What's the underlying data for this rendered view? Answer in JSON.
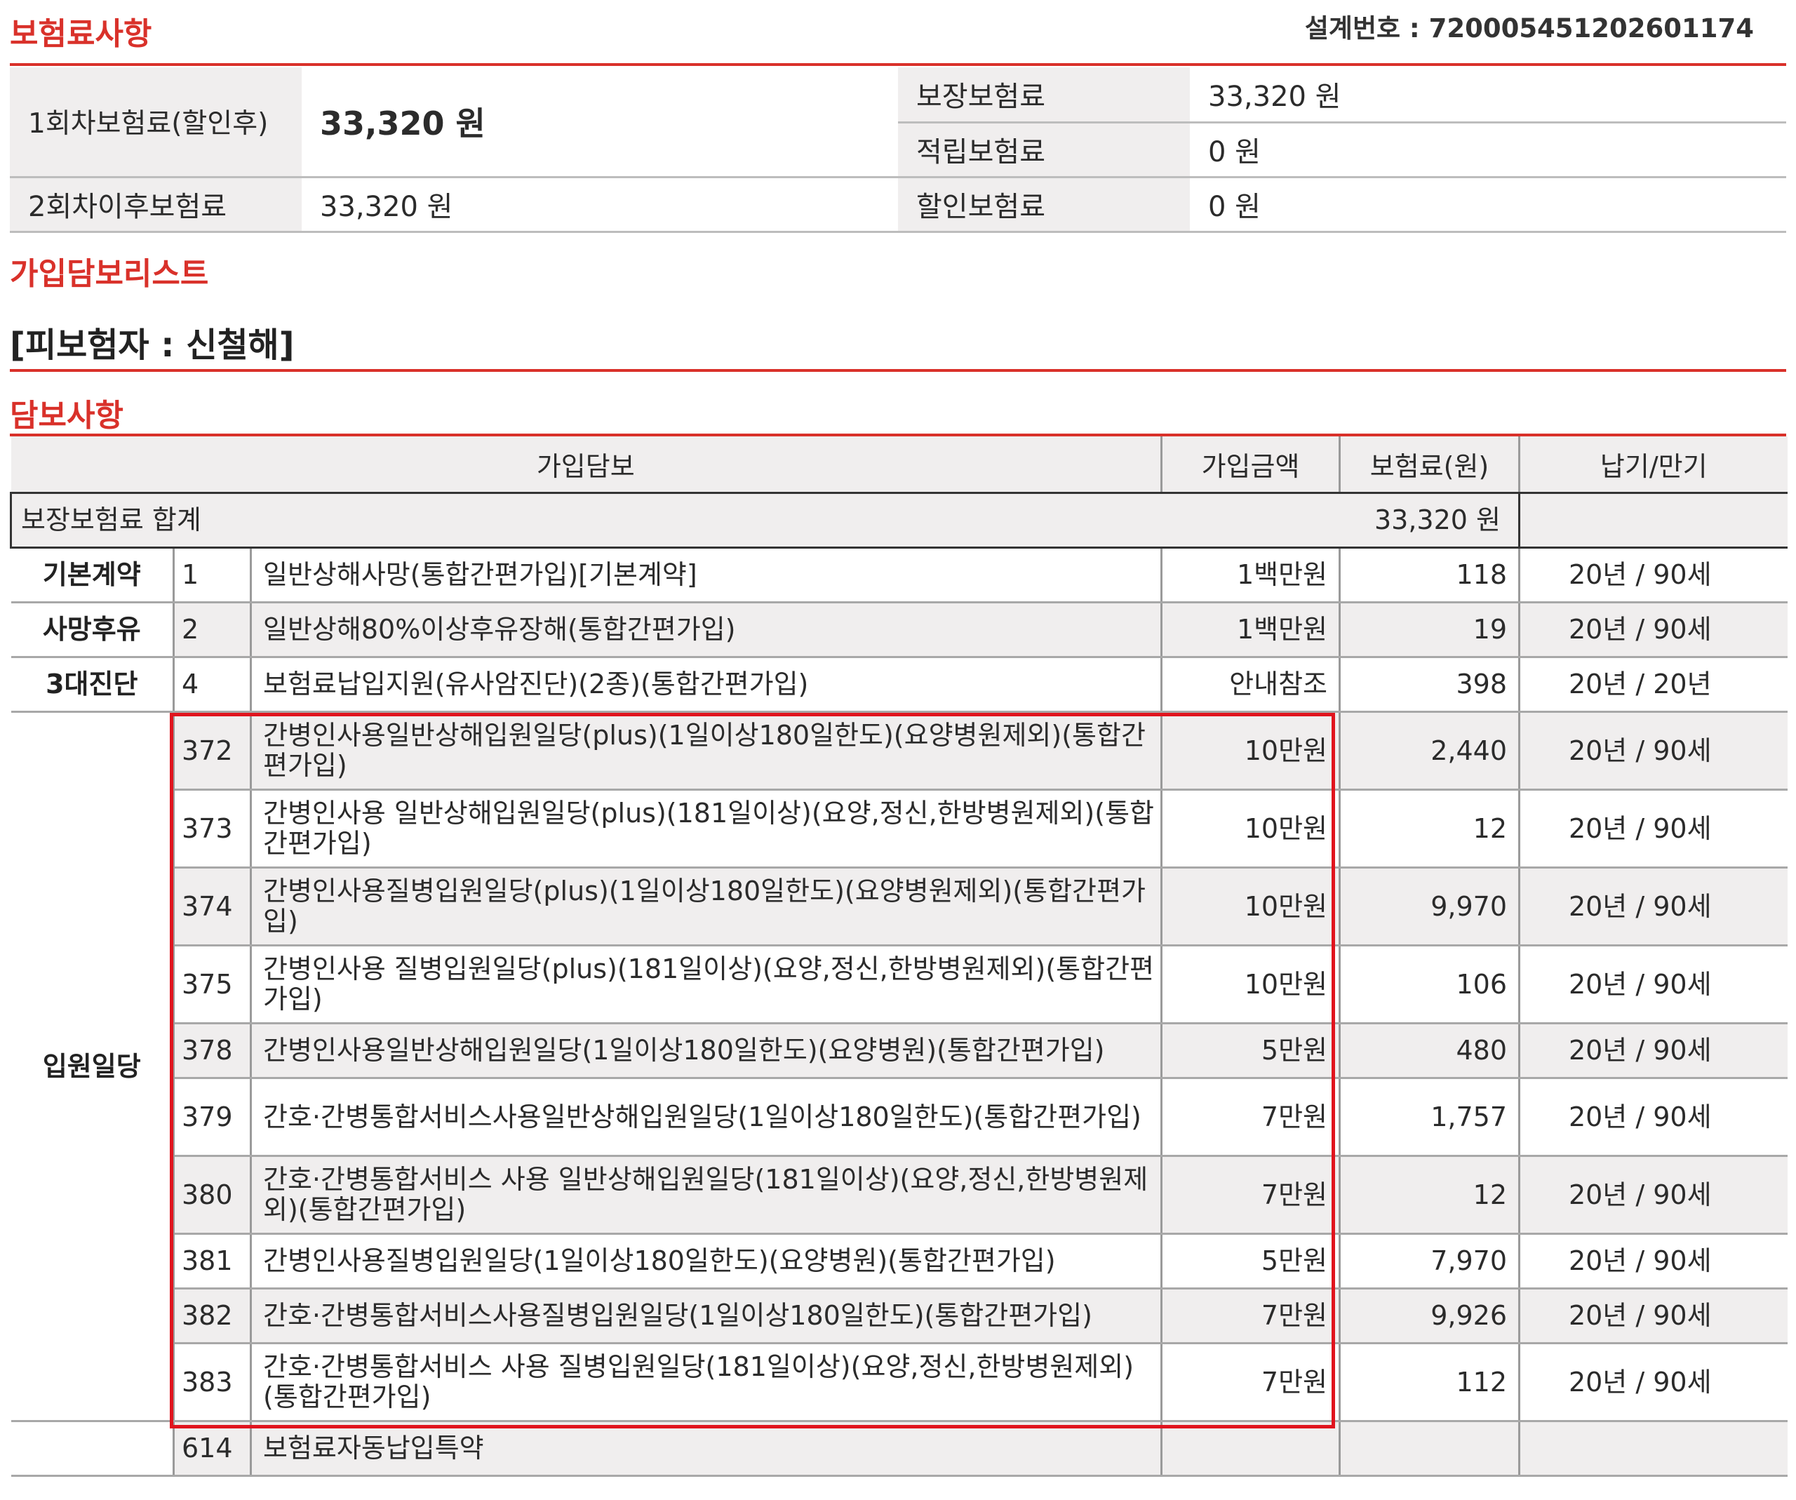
{
  "section1": {
    "title": "보험료사항",
    "design_no": "설계번호 : 720005451202601174"
  },
  "premium": {
    "first_label": "1회차보험료(할인후)",
    "first_value": "33,320 원",
    "after_label": "2회차이후보험료",
    "after_value": "33,320 원",
    "guarantee_label": "보장보험료",
    "guarantee_value": "33,320 원",
    "saving_label": "적립보험료",
    "saving_value": "0 원",
    "discount_label": "할인보험료",
    "discount_value": "0 원"
  },
  "section2": {
    "title": "가입담보리스트"
  },
  "insured": "[피보험자 : 신철해]",
  "section3": {
    "title": "담보사항"
  },
  "coverage": {
    "headers": {
      "name": "가입담보",
      "amount": "가입금액",
      "premium": "보험료(원)",
      "term": "납기/만기"
    },
    "sum_label": "보장보험료 합계",
    "sum_value": "33,320 원",
    "categories": {
      "basic": "기본계약",
      "death": "사망후유",
      "diag": "3대진단",
      "hosp": "입원일당"
    },
    "rows": [
      {
        "code": "1",
        "name": "일반상해사망(통합간편가입)[기본계약]",
        "amount": "1백만원",
        "premium": "118",
        "term": "20년 / 90세"
      },
      {
        "code": "2",
        "name": "일반상해80%이상후유장해(통합간편가입)",
        "amount": "1백만원",
        "premium": "19",
        "term": "20년 / 90세"
      },
      {
        "code": "4",
        "name": "보험료납입지원(유사암진단)(2종)(통합간편가입)",
        "amount": "안내참조",
        "premium": "398",
        "term": "20년 / 20년"
      },
      {
        "code": "372",
        "name": "간병인사용일반상해입원일당(plus)(1일이상180일한도)(요양병원제외)(통합간편가입)",
        "amount": "10만원",
        "premium": "2,440",
        "term": "20년 / 90세"
      },
      {
        "code": "373",
        "name": "간병인사용 일반상해입원일당(plus)(181일이상)(요양,정신,한방병원제외)(통합간편가입)",
        "amount": "10만원",
        "premium": "12",
        "term": "20년 / 90세"
      },
      {
        "code": "374",
        "name": "간병인사용질병입원일당(plus)(1일이상180일한도)(요양병원제외)(통합간편가입)",
        "amount": "10만원",
        "premium": "9,970",
        "term": "20년 / 90세"
      },
      {
        "code": "375",
        "name": "간병인사용 질병입원일당(plus)(181일이상)(요양,정신,한방병원제외)(통합간편가입)",
        "amount": "10만원",
        "premium": "106",
        "term": "20년 / 90세"
      },
      {
        "code": "378",
        "name": "간병인사용일반상해입원일당(1일이상180일한도)(요양병원)(통합간편가입)",
        "amount": "5만원",
        "premium": "480",
        "term": "20년 / 90세"
      },
      {
        "code": "379",
        "name": "간호·간병통합서비스사용일반상해입원일당(1일이상180일한도)(통합간편가입)",
        "amount": "7만원",
        "premium": "1,757",
        "term": "20년 / 90세"
      },
      {
        "code": "380",
        "name": "간호·간병통합서비스 사용 일반상해입원일당(181일이상)(요양,정신,한방병원제외)(통합간편가입)",
        "amount": "7만원",
        "premium": "12",
        "term": "20년 / 90세"
      },
      {
        "code": "381",
        "name": "간병인사용질병입원일당(1일이상180일한도)(요양병원)(통합간편가입)",
        "amount": "5만원",
        "premium": "7,970",
        "term": "20년 / 90세"
      },
      {
        "code": "382",
        "name": "간호·간병통합서비스사용질병입원일당(1일이상180일한도)(통합간편가입)",
        "amount": "7만원",
        "premium": "9,926",
        "term": "20년 / 90세"
      },
      {
        "code": "383",
        "name": "간호·간병통합서비스 사용 질병입원일당(181일이상)(요양,정신,한방병원제외)(통합간편가입)",
        "amount": "7만원",
        "premium": "112",
        "term": "20년 / 90세"
      },
      {
        "code": "614",
        "name": "보험료자동납입특약",
        "amount": "",
        "premium": "",
        "term": ""
      }
    ]
  },
  "colors": {
    "accent": "#d9312a",
    "highlight_box": "#e0141e",
    "label_bg": "#f0eeee"
  }
}
